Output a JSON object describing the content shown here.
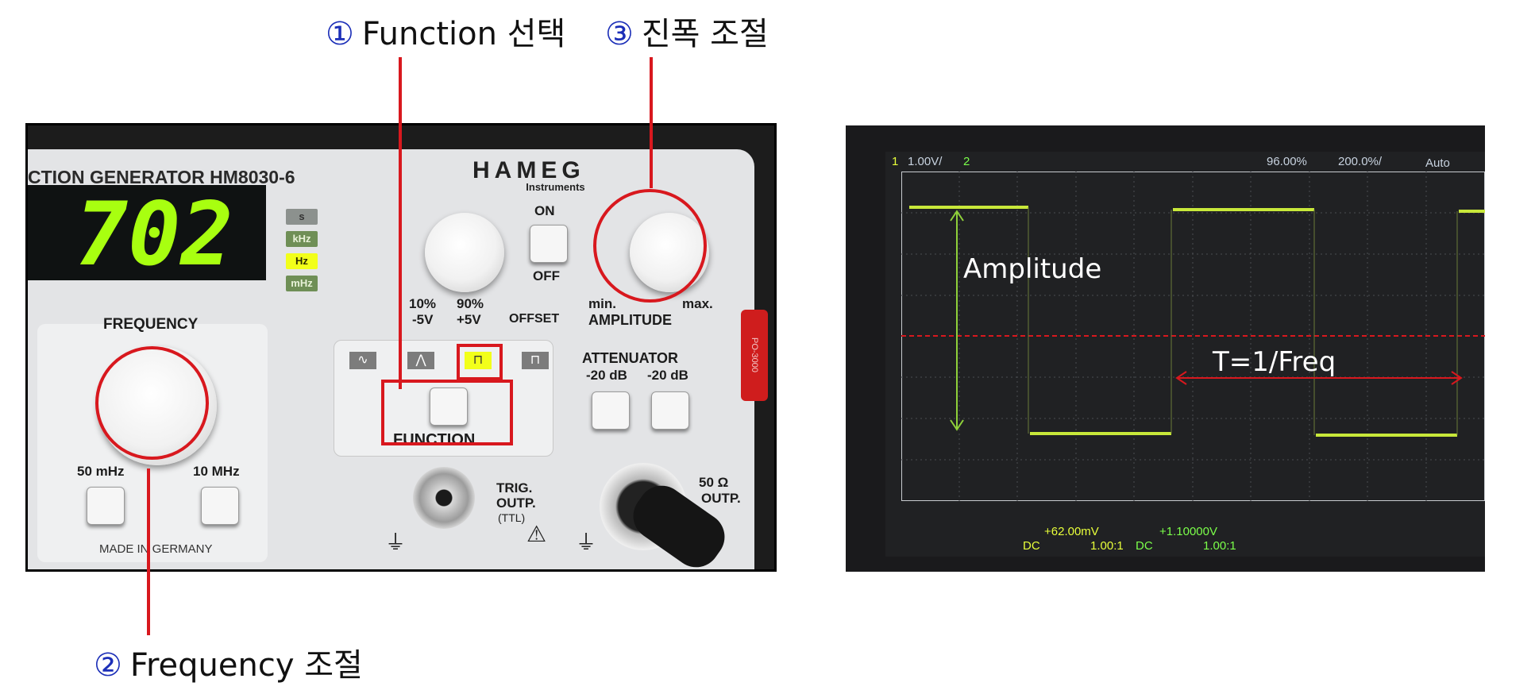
{
  "callouts": {
    "function": {
      "num": "①",
      "text": "Function 선택"
    },
    "amplitude": {
      "num": "③",
      "text": "진폭 조절"
    },
    "frequency": {
      "num": "②",
      "text": "Frequency 조절"
    }
  },
  "generator": {
    "model_label": "CTION GENERATOR HM8030-6",
    "brand": "HAMEG",
    "brand_sub": "Instruments",
    "display_digits": "702",
    "units": [
      "s",
      "kHz",
      "Hz",
      "mHz"
    ],
    "selected_unit": "Hz",
    "power_on": "ON",
    "power_off": "OFF",
    "offset_labels": {
      "left_pct": "10%",
      "left_v": "-5V",
      "right_pct": "90%",
      "right_v": "+5V",
      "offset": "OFFSET"
    },
    "amplitude_labels": {
      "min": "min.",
      "max": "max.",
      "title": "AMPLITUDE"
    },
    "frequency_title": "FREQUENCY",
    "freq_range": {
      "low": "50 mHz",
      "high": "10 MHz"
    },
    "made_in": "MADE IN GERMANY",
    "function_label": "FUNCTION",
    "attenuator": {
      "title": "ATTENUATOR",
      "a": "-20 dB",
      "b": "-20 dB"
    },
    "trig": {
      "line1": "TRIG.",
      "line2": "OUTP.",
      "line3": "(TTL)"
    },
    "outp": {
      "ohm": "50 Ω",
      "label": "OUTP."
    },
    "side_tag": "PO-3000"
  },
  "scope": {
    "ch1_label": "1",
    "ch1_scale": "1.00V/",
    "ch2_label": "2",
    "percent": "96.00%",
    "timebase": "200.0%/",
    "mode": "Auto",
    "bottom": {
      "v1": "+62.00mV",
      "v2": "+1.10000V",
      "dc1": "DC",
      "ratio1": "1.00:1",
      "dc2": "DC",
      "ratio2": "1.00:1"
    },
    "annotation_amplitude": "Amplitude",
    "annotation_period": "T=1/Freq",
    "wave_color": "#c8e83a"
  }
}
